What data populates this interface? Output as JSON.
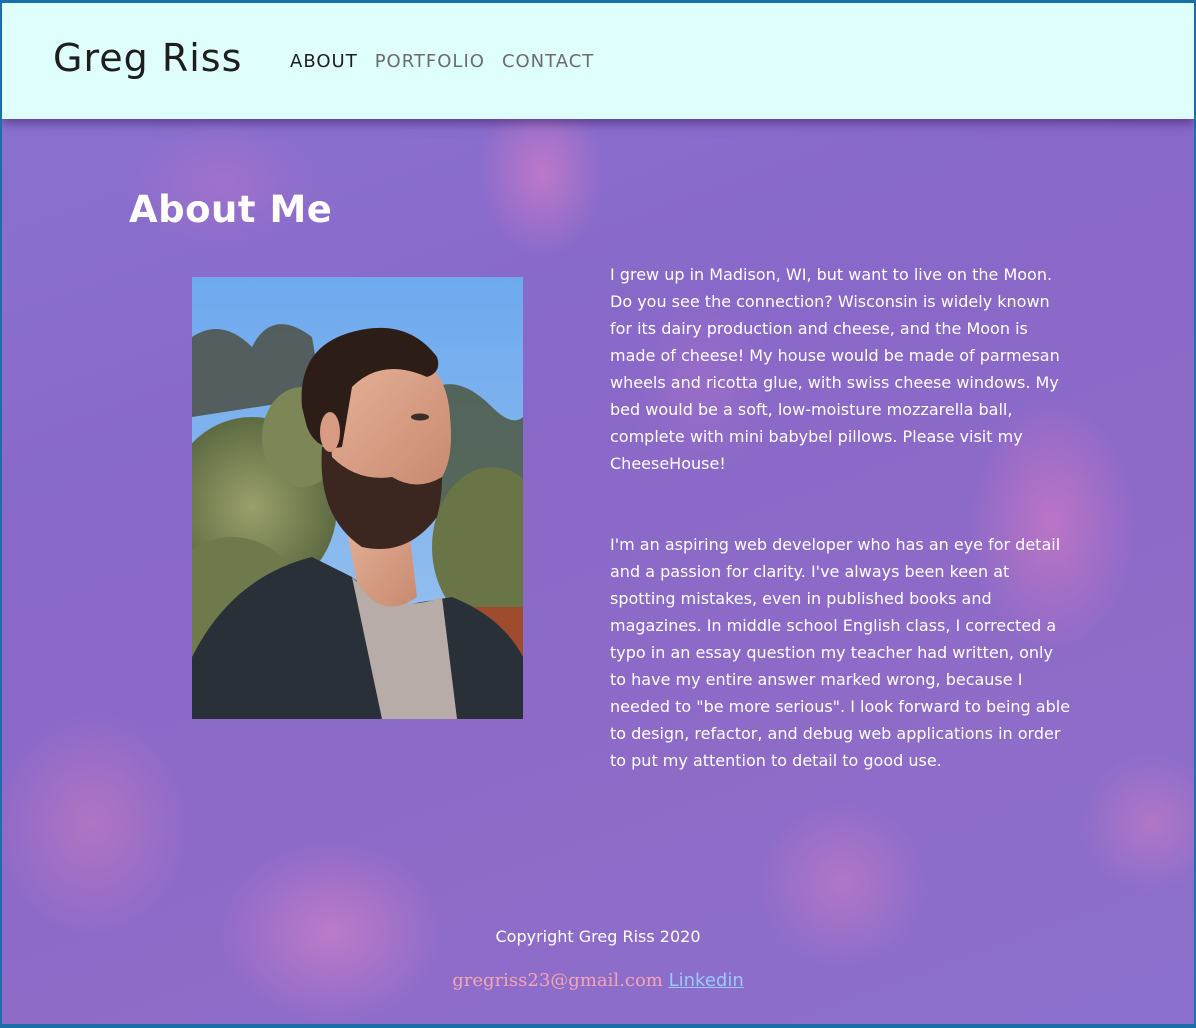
{
  "header": {
    "brand": "Greg Riss",
    "nav": [
      {
        "label": "ABOUT",
        "active": true
      },
      {
        "label": "PORTFOLIO",
        "active": false
      },
      {
        "label": "CONTACT",
        "active": false
      }
    ]
  },
  "main": {
    "title": "About Me",
    "bio": [
      "I grew up in Madison, WI, but want to live on the Moon. Do you see the connection? Wisconsin is widely known for its dairy production and cheese, and the Moon is made of cheese! My house would be made of parmesan wheels and ricotta glue, with swiss cheese windows. My bed would be a soft, low-moisture mozzarella ball, complete with mini babybel pillows. Please visit my CheeseHouse!",
      "I'm an aspiring web developer who has an eye for detail and a passion for clarity. I've always been keen at spotting mistakes, even in published books and magazines. In middle school English class, I corrected a typo in an essay question my teacher had written, only to have my entire answer marked wrong, because I needed to \"be more serious\". I look forward to being able to design, refactor, and debug web applications in order to put my attention to detail to good use."
    ]
  },
  "footer": {
    "copyright": "Copyright Greg Riss 2020",
    "email": "gregriss23@gmail.com",
    "linkedin": "Linkedin"
  },
  "colors": {
    "header_bg": "#dffffd",
    "page_bg": "#8a6ccb",
    "email": "#f4a5b4",
    "link": "#9bc9ff"
  }
}
